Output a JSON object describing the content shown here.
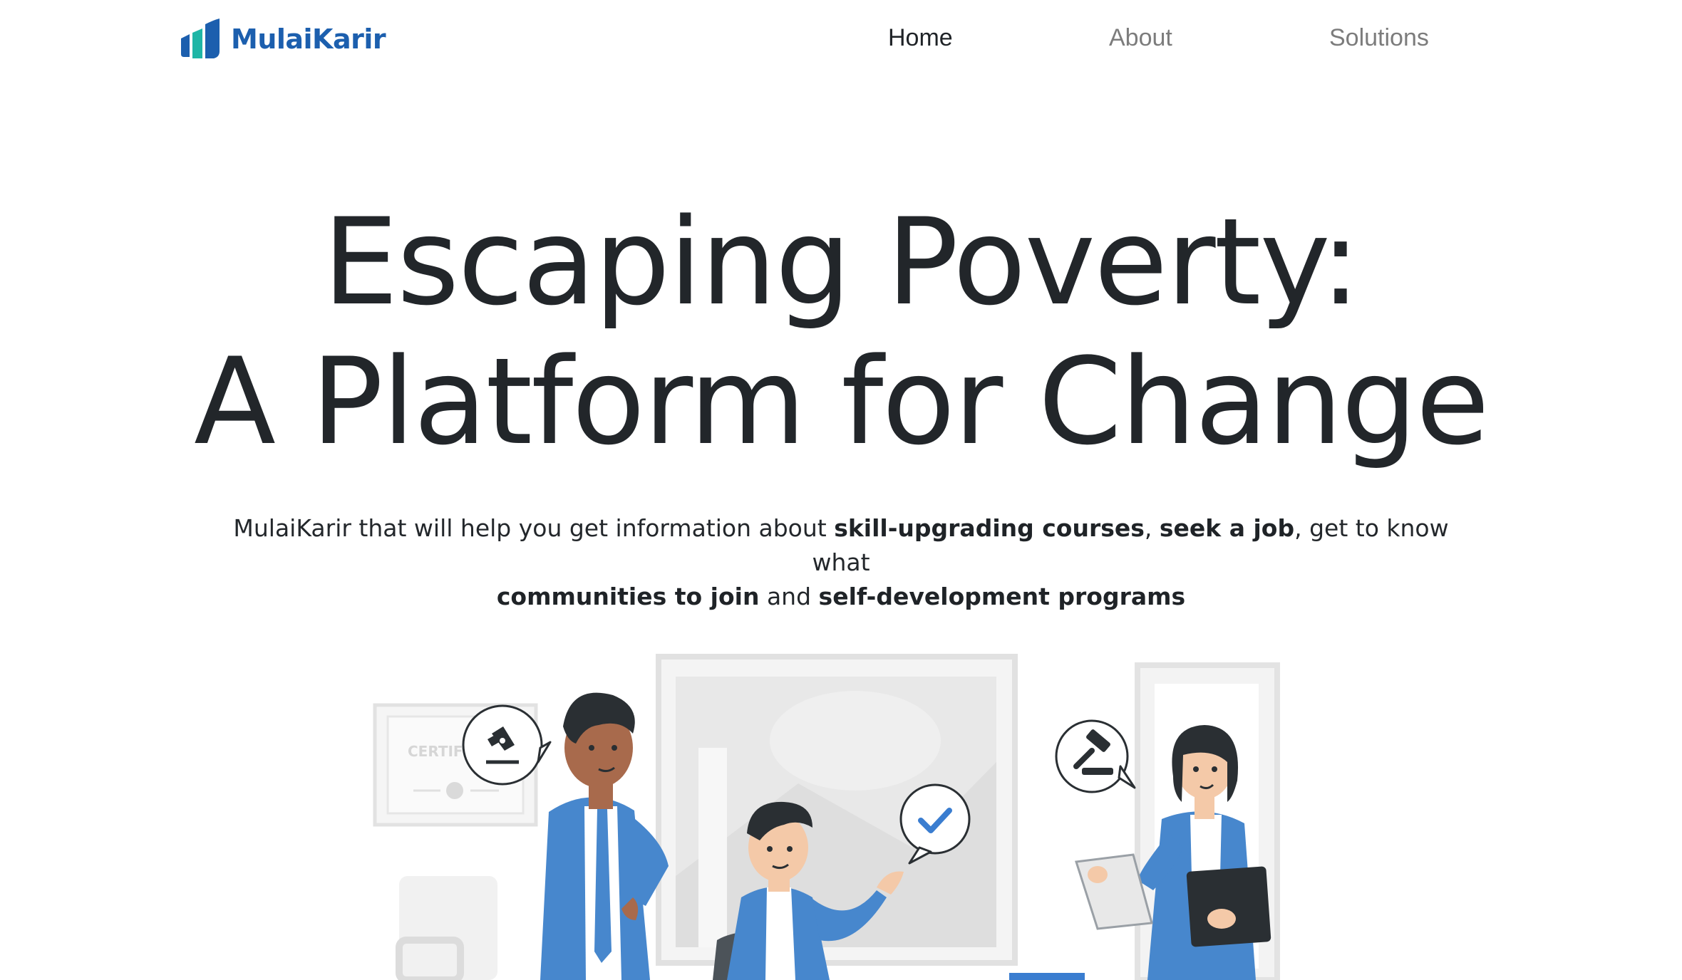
{
  "brand": {
    "name": "MulaiKarir"
  },
  "nav": {
    "items": [
      {
        "label": "Home",
        "active": true
      },
      {
        "label": "About",
        "active": false
      },
      {
        "label": "Solutions",
        "active": false
      }
    ]
  },
  "hero": {
    "title_line1": "Escaping Poverty:",
    "title_line2": "A Platform for Change",
    "description": {
      "p1": "MulaiKarir that will help you get information about ",
      "b1": "skill-upgrading courses",
      "p2": ", ",
      "b2": "seek a job",
      "p3": ", get to know what ",
      "b3": "communities to join",
      "p4": " and ",
      "b4": "self-development programs"
    }
  },
  "illustration": {
    "certificate_text": "CERTIFI",
    "icons": [
      "fountain-pen-icon",
      "checkmark-icon",
      "gavel-icon"
    ]
  },
  "colors": {
    "brand_blue": "#1c5fae",
    "brand_teal": "#1fb6a6",
    "suit_blue": "#4787cd",
    "text_dark": "#22262a",
    "nav_inactive": "#7c7c7c"
  }
}
